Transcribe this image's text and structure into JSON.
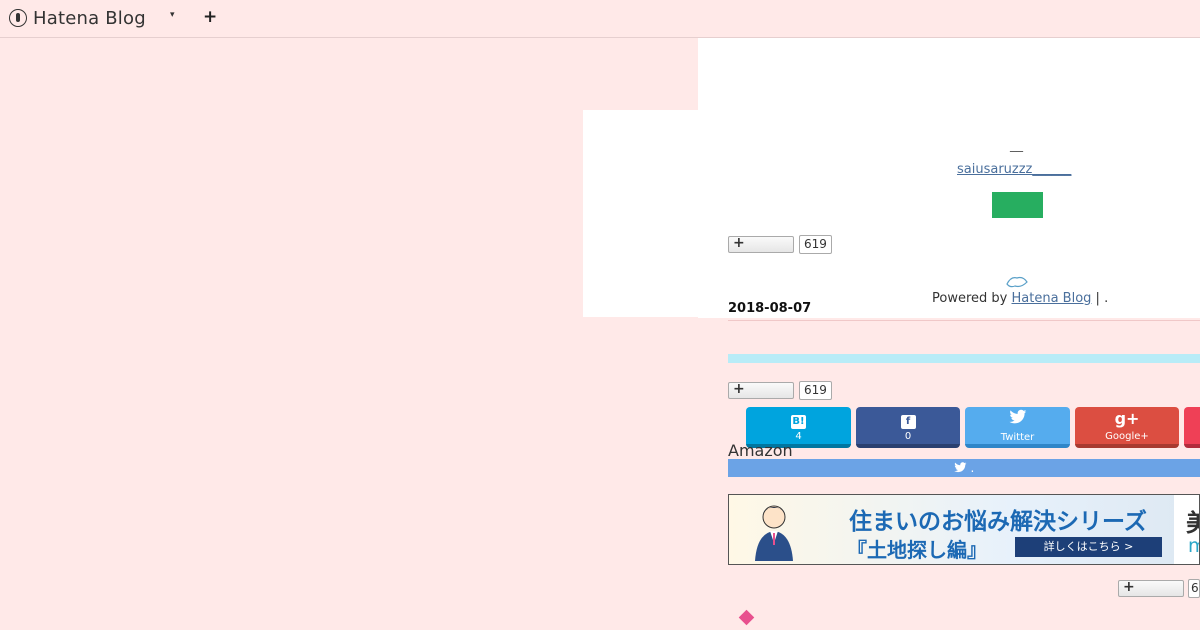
{
  "topbar": {
    "logo_text": "Hatena Blog",
    "dropdown_glyph": "▾",
    "add_glyph": "+"
  },
  "profile": {
    "dash_text": "__",
    "user_link": "saiusaruzzz______"
  },
  "bookmark": {
    "plus_glyph": "+",
    "count": "619",
    "count_bottom": "6"
  },
  "footer": {
    "powered_prefix": "Powered by",
    "powered_link": "Hatena Blog",
    "powered_suffix": " | ."
  },
  "entry": {
    "date": "2018-08-07",
    "amazon": "Amazon"
  },
  "share": {
    "hatena": {
      "icon": "B!",
      "label": "4"
    },
    "facebook": {
      "icon": "f",
      "label": "0"
    },
    "twitter": {
      "icon": "twitter-bird-icon",
      "label": "Twitter"
    },
    "googleplus": {
      "icon": "g+",
      "label": "Google+"
    }
  },
  "twitter_bar": {
    "text": "."
  },
  "banner": {
    "title": "住まいのお悩み解決シリーズ",
    "subtitle": "『土地探し編』",
    "cta": "詳しくはこちら >",
    "right_big": "美",
    "right_small": "m"
  },
  "colors": {
    "background": "#ffe9e8",
    "green_button": "#27ae60",
    "hatena_blue": "#00a4de",
    "facebook": "#3b5998",
    "twitter": "#55acee",
    "googleplus": "#dc4e41"
  }
}
